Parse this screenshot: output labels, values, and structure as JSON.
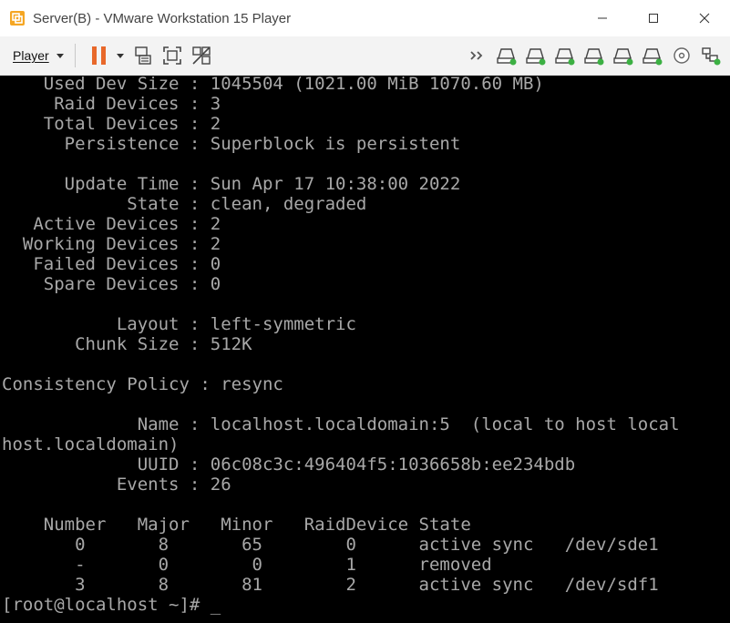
{
  "window": {
    "title": "Server(B) - VMware Workstation 15 Player",
    "minimize_icon": "minimize-icon",
    "maximize_icon": "maximize-icon",
    "close_icon": "close-icon"
  },
  "toolbar": {
    "player_label": "Player",
    "buttons": [
      "pause-icon",
      "dropdown-caret-icon",
      "send-ctrl-alt-del-icon",
      "fit-guest-icon",
      "unity-icon"
    ],
    "devices": [
      "forward-icon",
      "hard-disk-icon",
      "hard-disk-icon",
      "hard-disk-icon",
      "hard-disk-icon",
      "hard-disk-icon",
      "hard-disk-icon",
      "cd-dvd-icon",
      "network-adapter-icon"
    ],
    "colors": {
      "pause": "#e8682a",
      "device_led": "#3cb043"
    }
  },
  "terminal": {
    "lines": [
      "    Used Dev Size : 1045504 (1021.00 MiB 1070.60 MB)",
      "     Raid Devices : 3",
      "    Total Devices : 2",
      "      Persistence : Superblock is persistent",
      "",
      "      Update Time : Sun Apr 17 10:38:00 2022",
      "            State : clean, degraded",
      "   Active Devices : 2",
      "  Working Devices : 2",
      "   Failed Devices : 0",
      "    Spare Devices : 0",
      "",
      "           Layout : left-symmetric",
      "       Chunk Size : 512K",
      "",
      "Consistency Policy : resync",
      "",
      "             Name : localhost.localdomain:5  (local to host local",
      "host.localdomain)",
      "             UUID : 06c08c3c:496404f5:1036658b:ee234bdb",
      "           Events : 26",
      "",
      "    Number   Major   Minor   RaidDevice State",
      "       0       8       65        0      active sync   /dev/sde1",
      "       -       0        0        1      removed",
      "       3       8       81        2      active sync   /dev/sdf1"
    ],
    "prompt": "[root@localhost ~]# ",
    "cursor": "_",
    "colors": {
      "background": "#000000",
      "foreground": "#a8a8a8"
    }
  }
}
